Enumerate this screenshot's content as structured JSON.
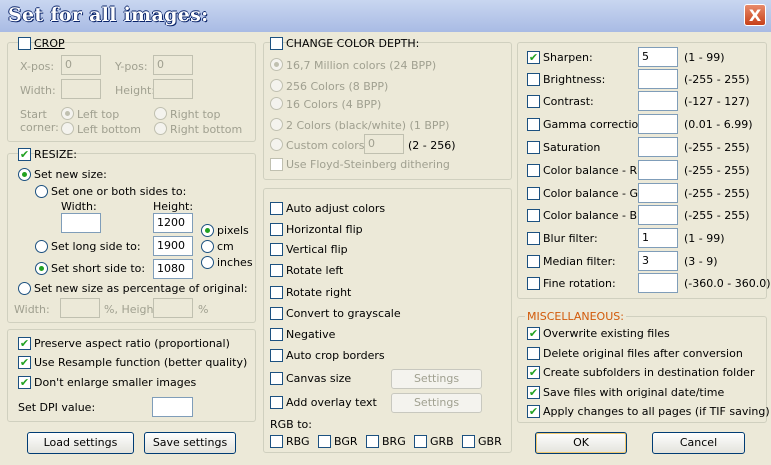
{
  "window": {
    "title": "Set for all images:",
    "close_label": "X"
  },
  "crop": {
    "label": "CROP",
    "checked": false,
    "xpos_label": "X-pos:",
    "xpos_value": "0",
    "ypos_label": "Y-pos:",
    "ypos_value": "0",
    "width_label": "Width:",
    "height_label": "Height:",
    "start_label_1": "Start",
    "start_label_2": "corner:",
    "corners": [
      "Left top",
      "Right top",
      "Left bottom",
      "Right bottom"
    ]
  },
  "resize": {
    "label": "RESIZE:",
    "checked": true,
    "set_new_size": "Set new size:",
    "one_or_both": "Set one or both sides to:",
    "width_label": "Width:",
    "height_label": "Height:",
    "width_value": "",
    "height_value": "1200",
    "long_side_label": "Set long side to:",
    "long_side_value": "1900",
    "short_side_label": "Set short side to:",
    "short_side_value": "1080",
    "units": [
      "pixels",
      "cm",
      "inches"
    ],
    "percentage_label": "Set new size as percentage of original:",
    "pct_width_label": "Width:",
    "pct_height_label": "%, Height:",
    "pct_suffix": "%"
  },
  "options": {
    "preserve_aspect": "Preserve aspect ratio (proportional)",
    "resample": "Use Resample function (better quality)",
    "dont_enlarge": "Don't enlarge smaller images",
    "dpi_label": "Set DPI value:",
    "dpi_value": ""
  },
  "buttons": {
    "load": "Load settings",
    "save": "Save settings",
    "ok": "OK",
    "cancel": "Cancel"
  },
  "color_depth": {
    "label": "CHANGE COLOR DEPTH:",
    "options": [
      "16,7 Million colors (24 BPP)",
      "256 Colors (8 BPP)",
      "16 Colors (4 BPP)",
      "2 Colors (black/white) (1 BPP)",
      "Custom colors:"
    ],
    "custom_value": "0",
    "custom_range": "(2 - 256)",
    "dithering": "Use Floyd-Steinberg dithering"
  },
  "transforms": {
    "items": [
      "Auto adjust colors",
      "Horizontal flip",
      "Vertical flip",
      "Rotate left",
      "Rotate right",
      "Convert to grayscale",
      "Negative",
      "Auto crop borders",
      "Canvas size",
      "Add overlay text"
    ],
    "settings_label": "Settings",
    "rgb_label": "RGB to:",
    "rgb_options": [
      "RBG",
      "BGR",
      "BRG",
      "GRB",
      "GBR"
    ]
  },
  "adjust": {
    "items": [
      {
        "label": "Sharpen:",
        "value": "5",
        "range": "(1  -  99)",
        "checked": true
      },
      {
        "label": "Brightness:",
        "value": "",
        "range": "(-255  -  255)",
        "checked": false
      },
      {
        "label": "Contrast:",
        "value": "",
        "range": "(-127  -  127)",
        "checked": false
      },
      {
        "label": "Gamma correction:",
        "value": "",
        "range": "(0.01  -  6.99)",
        "checked": false
      },
      {
        "label": "Saturation",
        "value": "",
        "range": "(-255  -  255)",
        "checked": false
      },
      {
        "label": "Color balance - R:",
        "value": "",
        "range": "(-255  -  255)",
        "checked": false
      },
      {
        "label": "Color balance - G:",
        "value": "",
        "range": "(-255  -  255)",
        "checked": false
      },
      {
        "label": "Color balance - B:",
        "value": "",
        "range": "(-255  -  255)",
        "checked": false
      },
      {
        "label": "Blur filter:",
        "value": "1",
        "range": "(1  -  99)",
        "checked": false
      },
      {
        "label": "Median filter:",
        "value": "3",
        "range": "(3  -  9)",
        "checked": false
      },
      {
        "label": "Fine rotation:",
        "value": "",
        "range": "(-360.0  -  360.0)",
        "checked": false
      }
    ]
  },
  "misc": {
    "label": "MISCELLANEOUS:",
    "items": [
      {
        "label": "Overwrite existing files",
        "checked": true
      },
      {
        "label": "Delete original files after conversion",
        "checked": false
      },
      {
        "label": "Create subfolders in destination folder",
        "checked": true
      },
      {
        "label": "Save files with original date/time",
        "checked": true
      },
      {
        "label": "Apply changes to all pages (if TIF saving)",
        "checked": true
      }
    ]
  },
  "colors": {
    "check": "#21a121",
    "accent": "#d25a0a",
    "title": "#ffffff",
    "close": "#c7411a"
  }
}
